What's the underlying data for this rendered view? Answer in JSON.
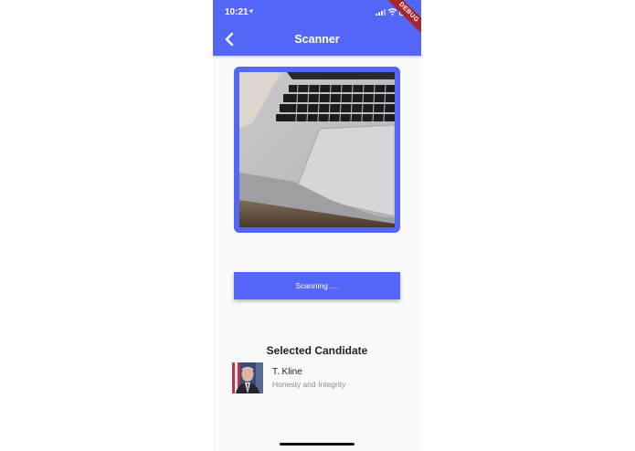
{
  "status_bar": {
    "time": "10:21",
    "debug_label": "DEBUG"
  },
  "app_bar": {
    "title": "Scanner",
    "back_icon": "chevron-left-icon",
    "color": "#5466f5"
  },
  "scan_button": {
    "label": "Scanning ...."
  },
  "selected_section": {
    "title": "Selected Candidate",
    "candidate": {
      "name": "T. Kline",
      "tagline": "Honesty and Integrity"
    }
  },
  "colors": {
    "accent": "#5466f5",
    "background": "#fafafa",
    "debug_banner": "#a8262b"
  }
}
